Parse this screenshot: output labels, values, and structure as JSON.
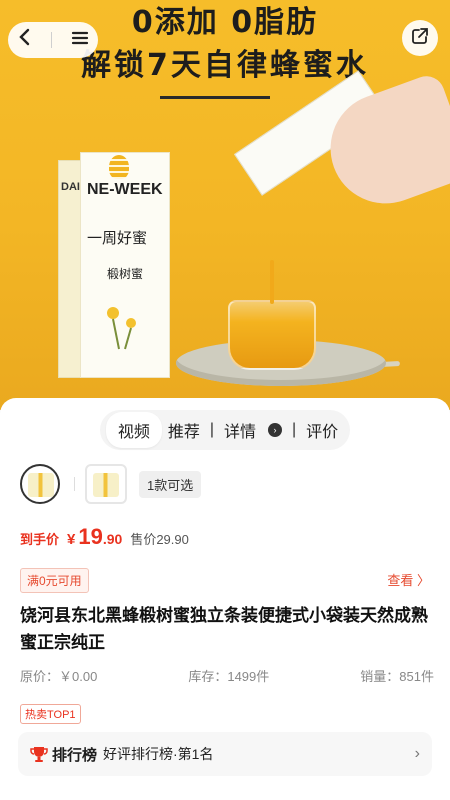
{
  "hero": {
    "headline_line1": "0添加 0脂肪",
    "headline_line2": "解锁7天自律蜂蜜水",
    "box_brand_side": "DAILY",
    "box_title": "NE-WEEK",
    "box_subtitle": "一周好蜜",
    "box_variety": "椴树蜜"
  },
  "nav": {
    "back_icon": "chevron-left-icon",
    "menu_icon": "menu-icon",
    "share_icon": "share-icon"
  },
  "tabs": [
    {
      "label": "视频",
      "active": true
    },
    {
      "label": "推荐",
      "active": false
    },
    {
      "label": "详情",
      "active": false
    },
    {
      "label": "评价",
      "active": false
    }
  ],
  "sku": {
    "count_label": "1款可选"
  },
  "price": {
    "label": "到手价",
    "currency": "¥",
    "integer": "19",
    "decimal": ".90",
    "original_label": "售价29.90"
  },
  "coupon": {
    "label": "满0元可用",
    "view_label": "查看 〉"
  },
  "product": {
    "title": "饶河县东北黑蜂椴树蜜独立条装便捷式小袋装天然成熟蜜正宗纯正"
  },
  "stats": {
    "original_price": "原价：￥0.00",
    "stock": "库存：1499件",
    "sales": "销量：851件"
  },
  "tag": {
    "hot": "热卖TOP1"
  },
  "ranking": {
    "brand": "排行榜",
    "text": "好评排行榜·第1名",
    "chevron": "›"
  },
  "colors": {
    "accent": "#e9321f",
    "hero_bg": "#f4b826"
  }
}
